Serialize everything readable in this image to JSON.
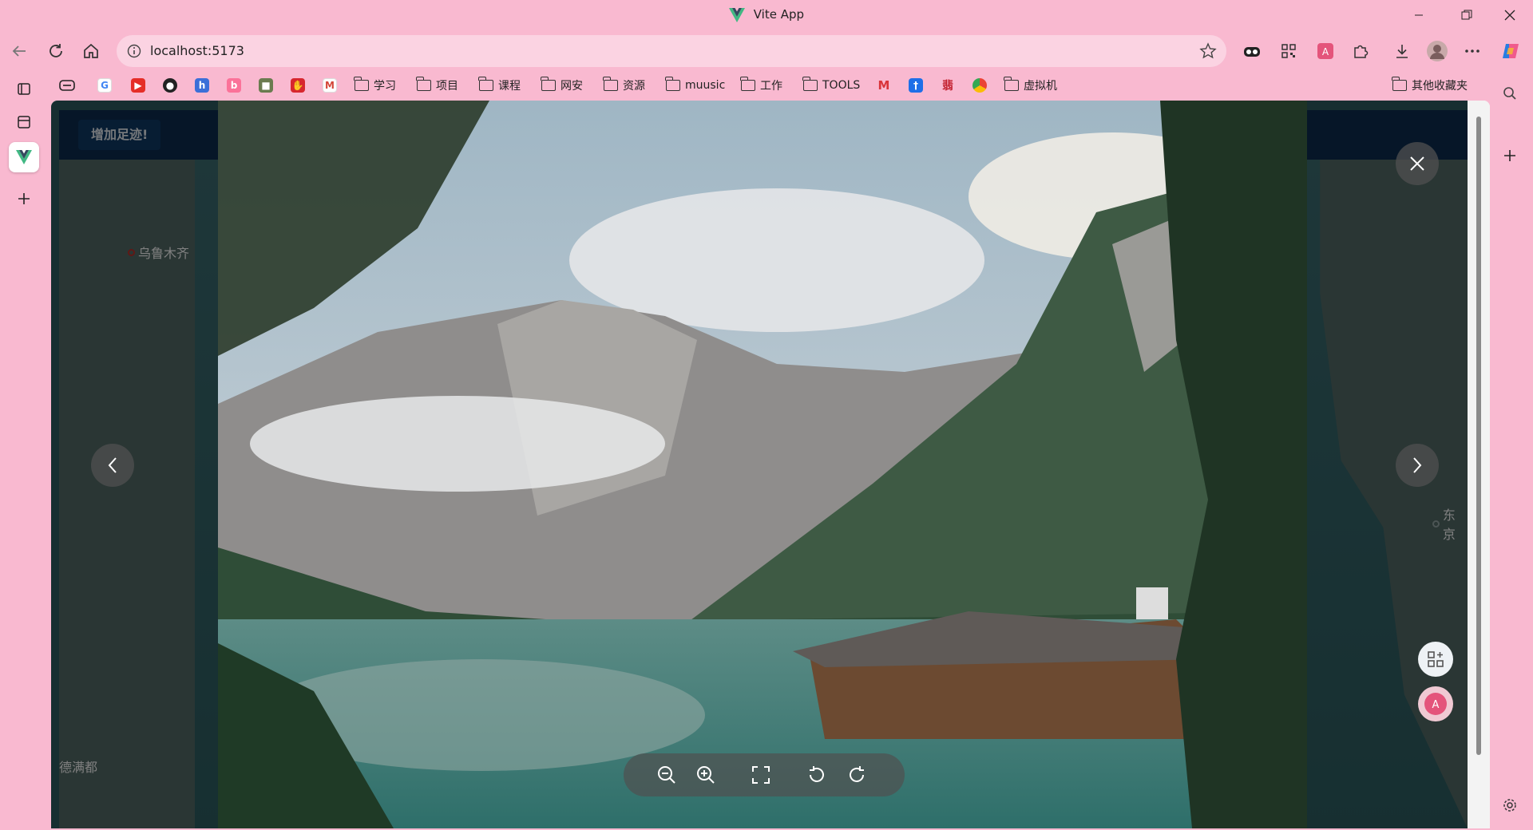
{
  "window": {
    "title": "Vite App"
  },
  "toolbar": {
    "url": "localhost:5173"
  },
  "bookmarks": {
    "folders": [
      "学习",
      "项目",
      "课程",
      "网安",
      "资源",
      "muusic",
      "工作",
      "TOOLS",
      "虚拟机"
    ],
    "other": "其他收藏夹"
  },
  "page": {
    "add_button": "增加足迹!",
    "cities": [
      "乌鲁木齐",
      "东京",
      "德满都"
    ]
  },
  "colors": {
    "chrome": "#f9b9d0",
    "header": "#0d2d51",
    "map_sea": "#2f5d63"
  }
}
